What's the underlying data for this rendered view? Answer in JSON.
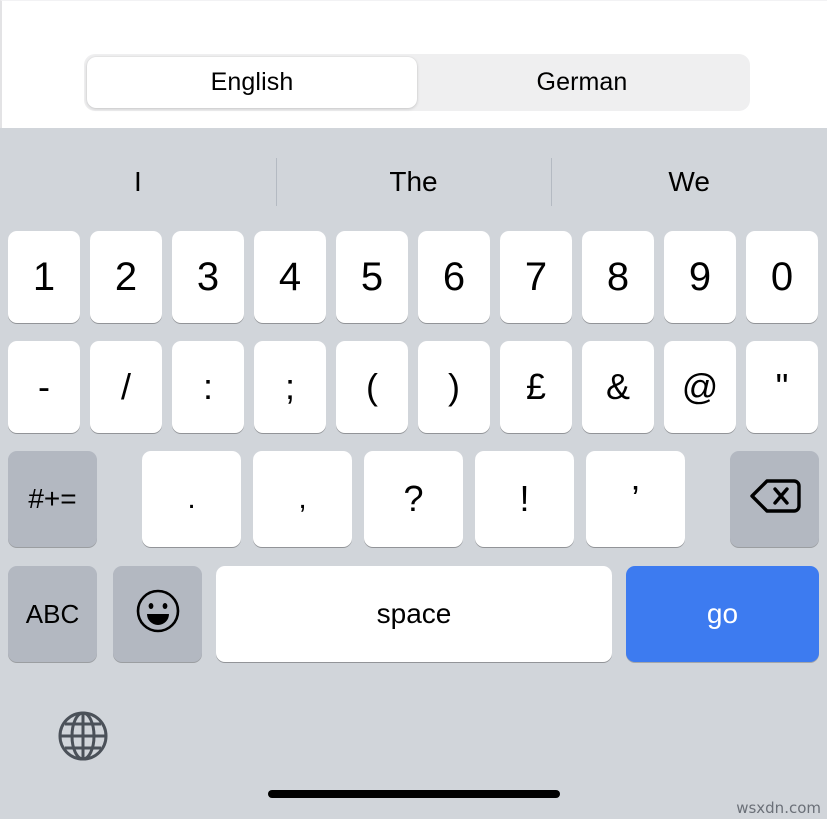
{
  "language_switcher": {
    "options": [
      {
        "label": "English",
        "selected": true
      },
      {
        "label": "German",
        "selected": false
      }
    ]
  },
  "suggestions": {
    "items": [
      {
        "text": "I"
      },
      {
        "text": "The"
      },
      {
        "text": "We"
      }
    ]
  },
  "keyboard": {
    "mode": "numeric-symbols",
    "rows": {
      "numbers": [
        "1",
        "2",
        "3",
        "4",
        "5",
        "6",
        "7",
        "8",
        "9",
        "0"
      ],
      "symbols": [
        "-",
        "/",
        ":",
        ";",
        "(",
        ")",
        "£",
        "&",
        "@",
        "\""
      ],
      "punctuation": {
        "shift_label": "#+=",
        "keys": [
          ".",
          ",",
          "?",
          "!",
          "’"
        ],
        "delete_icon": "backspace-delete-icon"
      },
      "bottom": {
        "abc_label": "ABC",
        "emoji_icon": "emoji-smiley-icon",
        "space_label": "space",
        "return_label": "go"
      }
    }
  },
  "globe": {
    "icon": "globe-icon"
  },
  "home_indicator": {
    "visible": true
  },
  "watermark": {
    "text": "wsxdn.com"
  },
  "colors": {
    "keyboard_background": "#d1d5da",
    "key_white": "#ffffff",
    "key_gray": "#b3b8c1",
    "accent_blue": "#3d7bf0",
    "segment_track": "#efeff0"
  }
}
